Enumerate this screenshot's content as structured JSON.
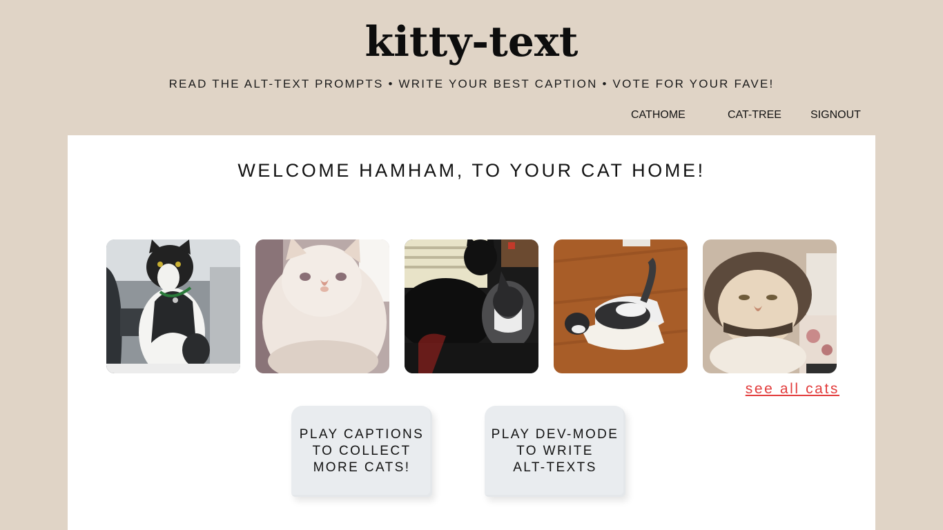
{
  "header": {
    "title": "kitty-text",
    "tagline": "READ THE ALT-TEXT PROMPTS • WRITE YOUR BEST CAPTION • VOTE FOR YOUR FAVE!"
  },
  "nav": {
    "items": [
      {
        "label": "CATHOME"
      },
      {
        "label": "CAT-TREE"
      },
      {
        "label": "SIGNOUT"
      }
    ]
  },
  "main": {
    "welcome": "WELCOME HAMHAM, TO YOUR CAT HOME!",
    "see_all_label": "see all cats",
    "play_captions_label": "PLAY CAPTIONS\nTO COLLECT\nMORE CATS!",
    "play_devmode_label": "PLAY DEV-MODE\nTO WRITE\nALT-TEXTS"
  },
  "colors": {
    "page_bg": "#e0d4c6",
    "panel_bg": "#ffffff",
    "link_red": "#e23b3b",
    "button_bg": "#e9ecef"
  }
}
